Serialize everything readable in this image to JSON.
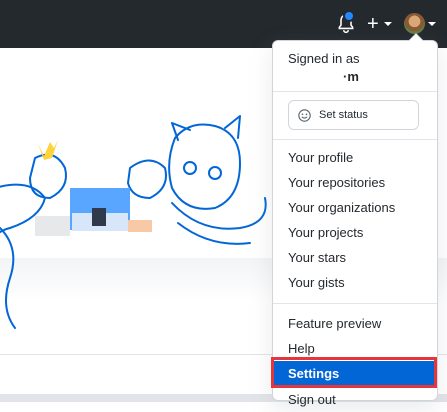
{
  "topbar": {
    "bell_icon": "bell-icon",
    "plus_label": "+",
    "avatar_icon": "avatar"
  },
  "menu": {
    "signed_in_label": "Signed in as",
    "username": "·m",
    "set_status_label": "Set status",
    "items": [
      {
        "label": "Your profile"
      },
      {
        "label": "Your repositories"
      },
      {
        "label": "Your organizations"
      },
      {
        "label": "Your projects"
      },
      {
        "label": "Your stars"
      },
      {
        "label": "Your gists"
      },
      {
        "label": "Feature preview"
      },
      {
        "label": "Help"
      },
      {
        "label": "Settings"
      },
      {
        "label": "Sign out"
      }
    ]
  },
  "colors": {
    "topbar_bg": "#24292e",
    "accent": "#0366d6",
    "highlight": "#e5363b",
    "notification_dot": "#2188ff"
  }
}
